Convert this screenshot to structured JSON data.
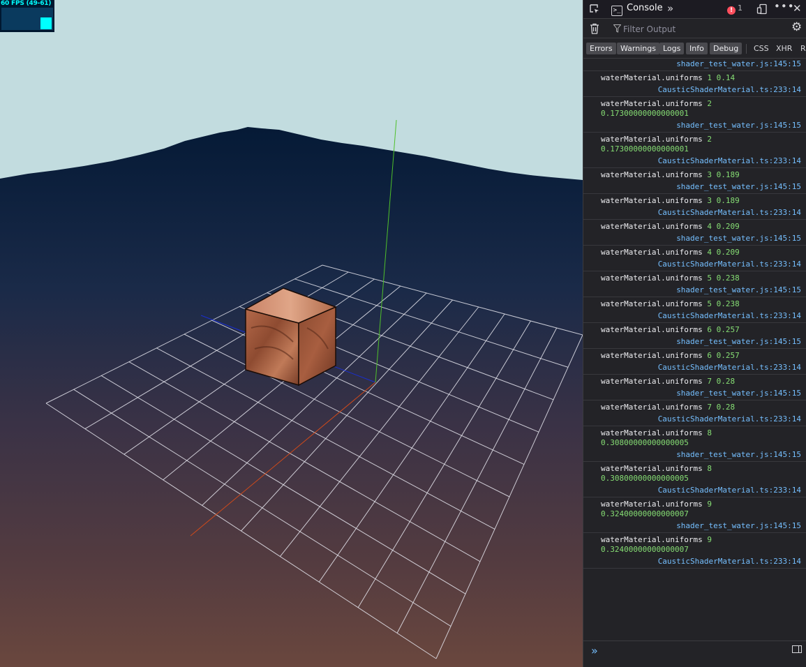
{
  "stats": {
    "fps_text": "60 FPS (49-61)",
    "fps_value": 60,
    "fps_min": 49,
    "fps_max": 61
  },
  "devtools": {
    "tab_label": "Console",
    "error_count": "1",
    "filter_placeholder": "Filter Output",
    "levels": [
      "Errors",
      "Warnings",
      "Logs",
      "Info",
      "Debug"
    ],
    "extra_filters": [
      "CSS",
      "XHR",
      "R"
    ],
    "first_location": "shader_test_water.js:145:15",
    "messages": [
      {
        "label": "waterMaterial.uniforms",
        "a": "1",
        "b": "0.14",
        "wrap": false,
        "loc": "CausticShaderMaterial.ts:233:14"
      },
      {
        "label": "waterMaterial.uniforms",
        "a": "2",
        "b": "0.17300000000000001",
        "wrap": true,
        "loc": "shader_test_water.js:145:15"
      },
      {
        "label": "waterMaterial.uniforms",
        "a": "2",
        "b": "0.17300000000000001",
        "wrap": true,
        "loc": "CausticShaderMaterial.ts:233:14"
      },
      {
        "label": "waterMaterial.uniforms",
        "a": "3",
        "b": "0.189",
        "wrap": false,
        "loc": "shader_test_water.js:145:15"
      },
      {
        "label": "waterMaterial.uniforms",
        "a": "3",
        "b": "0.189",
        "wrap": false,
        "loc": "CausticShaderMaterial.ts:233:14"
      },
      {
        "label": "waterMaterial.uniforms",
        "a": "4",
        "b": "0.209",
        "wrap": false,
        "loc": "shader_test_water.js:145:15"
      },
      {
        "label": "waterMaterial.uniforms",
        "a": "4",
        "b": "0.209",
        "wrap": false,
        "loc": "CausticShaderMaterial.ts:233:14"
      },
      {
        "label": "waterMaterial.uniforms",
        "a": "5",
        "b": "0.238",
        "wrap": false,
        "loc": "shader_test_water.js:145:15"
      },
      {
        "label": "waterMaterial.uniforms",
        "a": "5",
        "b": "0.238",
        "wrap": false,
        "loc": "CausticShaderMaterial.ts:233:14"
      },
      {
        "label": "waterMaterial.uniforms",
        "a": "6",
        "b": "0.257",
        "wrap": false,
        "loc": "shader_test_water.js:145:15"
      },
      {
        "label": "waterMaterial.uniforms",
        "a": "6",
        "b": "0.257",
        "wrap": false,
        "loc": "CausticShaderMaterial.ts:233:14"
      },
      {
        "label": "waterMaterial.uniforms",
        "a": "7",
        "b": "0.28",
        "wrap": false,
        "loc": "shader_test_water.js:145:15"
      },
      {
        "label": "waterMaterial.uniforms",
        "a": "7",
        "b": "0.28",
        "wrap": false,
        "loc": "CausticShaderMaterial.ts:233:14"
      },
      {
        "label": "waterMaterial.uniforms",
        "a": "8",
        "b": "0.30800000000000005",
        "wrap": true,
        "loc": "shader_test_water.js:145:15"
      },
      {
        "label": "waterMaterial.uniforms",
        "a": "8",
        "b": "0.30800000000000005",
        "wrap": true,
        "loc": "CausticShaderMaterial.ts:233:14"
      },
      {
        "label": "waterMaterial.uniforms",
        "a": "9",
        "b": "0.32400000000000007",
        "wrap": true,
        "loc": "shader_test_water.js:145:15"
      },
      {
        "label": "waterMaterial.uniforms",
        "a": "9",
        "b": "0.32400000000000007",
        "wrap": true,
        "loc": "CausticShaderMaterial.ts:233:14"
      }
    ]
  },
  "scene": {
    "sky_color": "#c2dcdf",
    "axis_y_color": "#4fc02a",
    "axis_x_color": "#d04a1a",
    "axis_z_color": "#1a2fd0",
    "grid_color": "#e6e6ee",
    "cube_color": "#a05a3a"
  }
}
